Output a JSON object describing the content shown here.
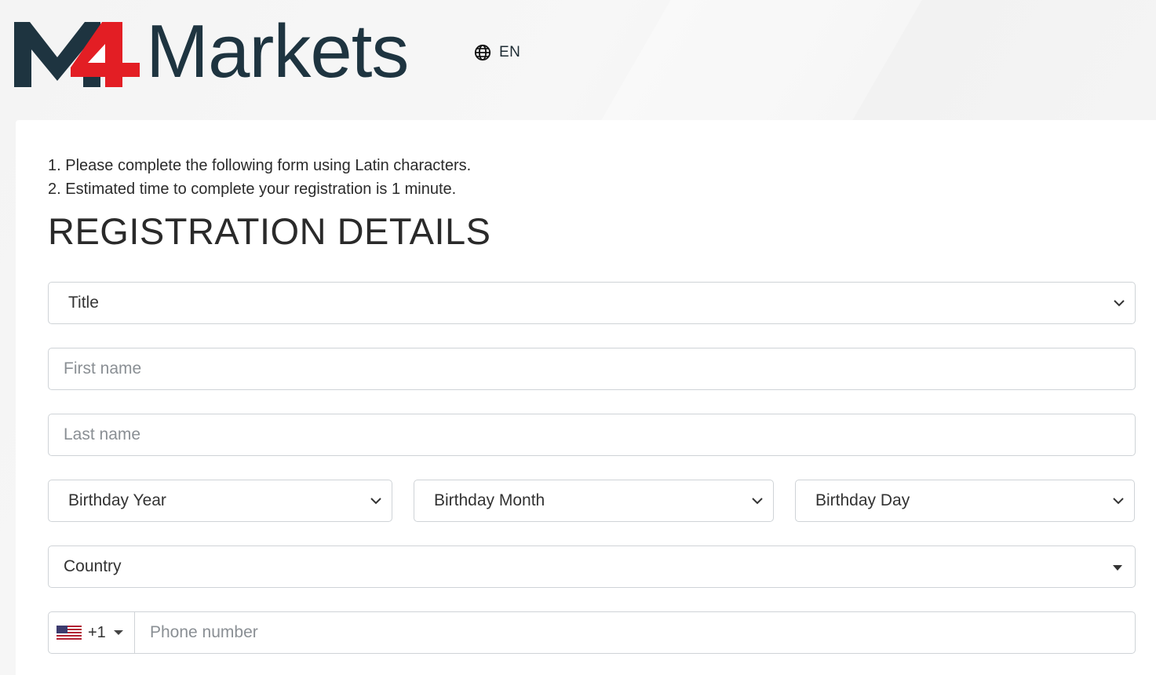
{
  "brand": {
    "logo_text": "M4Markets",
    "logo_mark": "M4",
    "logo_word": "Markets",
    "dark_color": "#1e3440",
    "accent_color": "#e31e24"
  },
  "language": {
    "icon": "globe-icon",
    "label": "EN"
  },
  "notes": {
    "line1": "1. Please complete the following form using Latin characters.",
    "line2": "2. Estimated time to complete your registration is 1 minute."
  },
  "form": {
    "heading": "REGISTRATION DETAILS",
    "title_select": "Title",
    "first_name_placeholder": "First name",
    "last_name_placeholder": "Last name",
    "birthday_year": "Birthday Year",
    "birthday_month": "Birthday Month",
    "birthday_day": "Birthday Day",
    "country": "Country",
    "phone": {
      "flag": "us-flag-icon",
      "code": "+1",
      "placeholder": "Phone number"
    }
  }
}
